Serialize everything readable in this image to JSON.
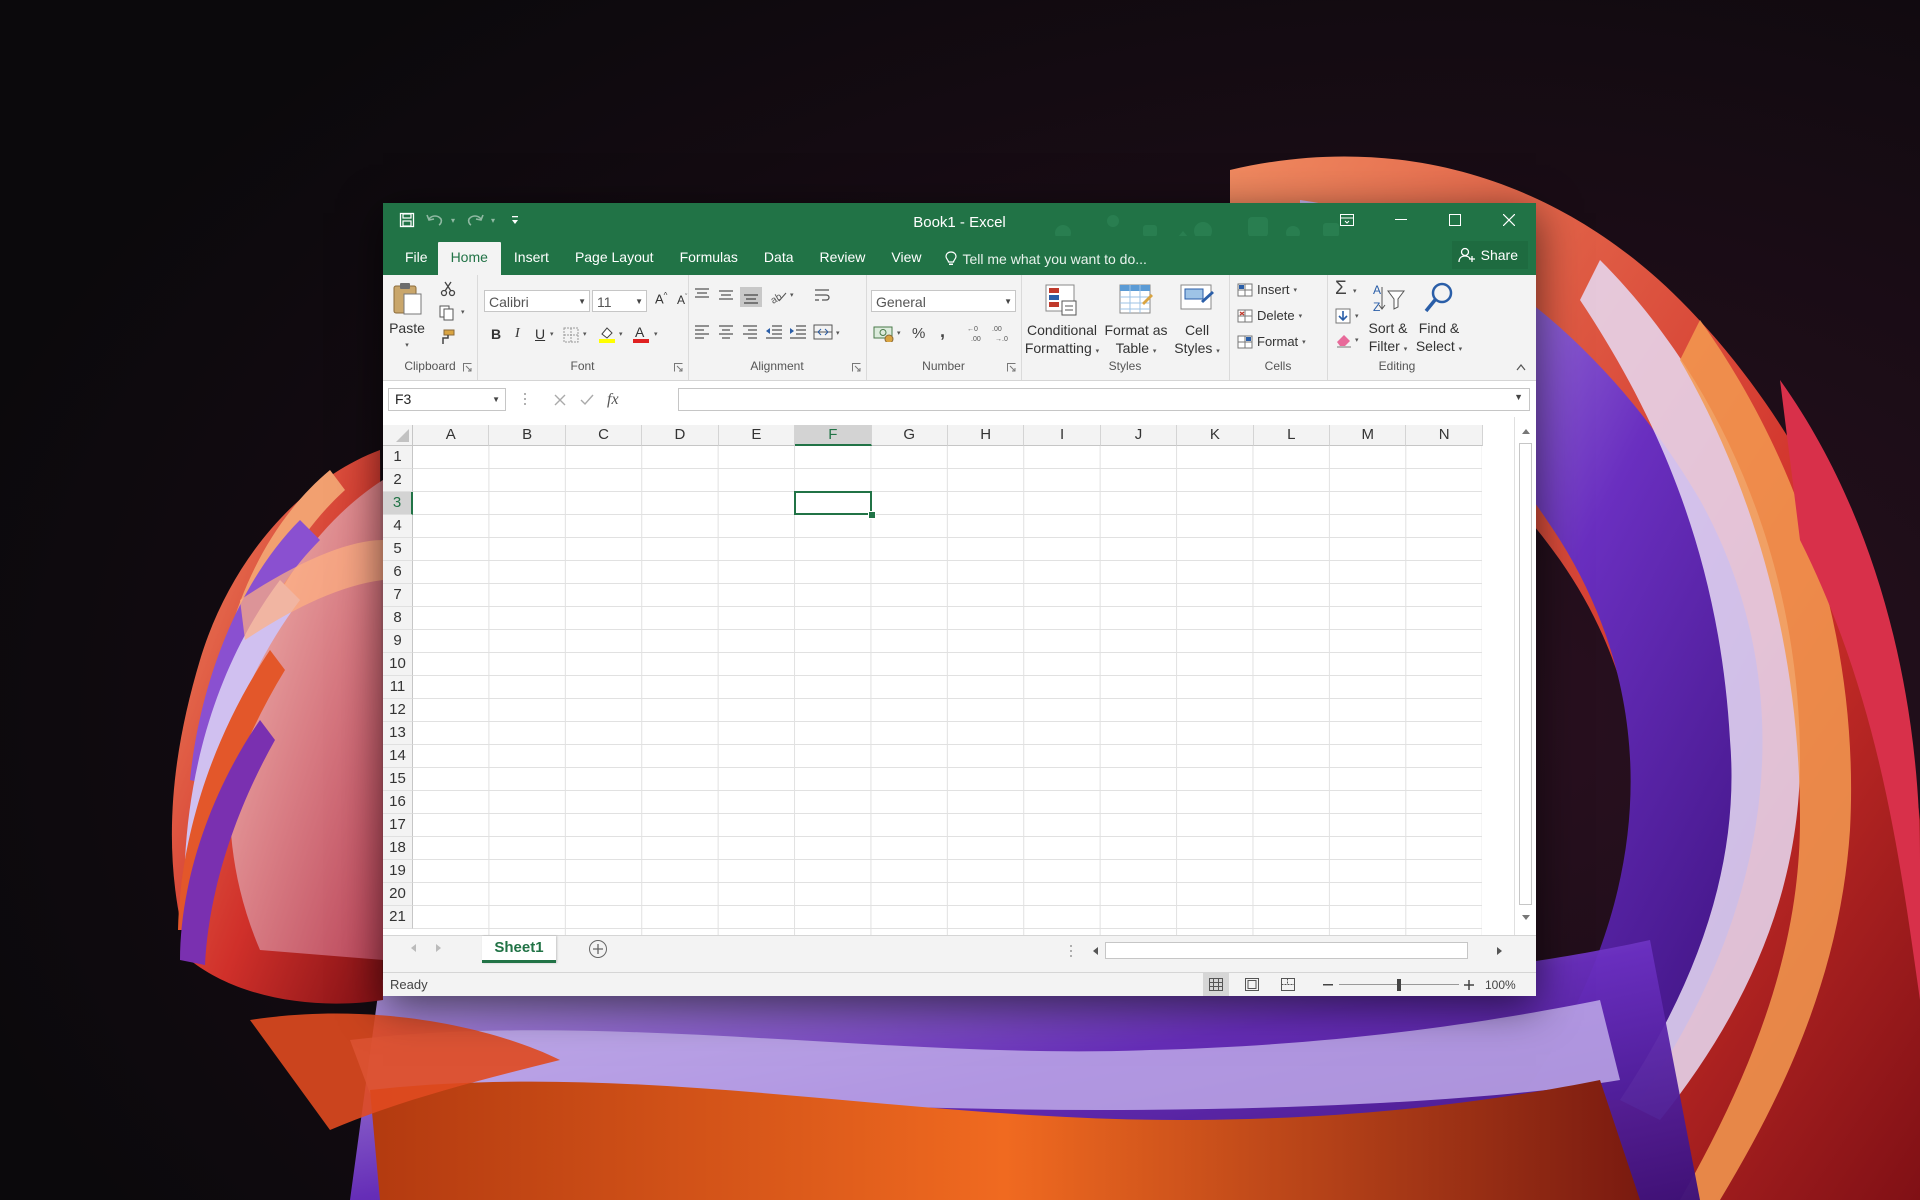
{
  "window": {
    "title": "Book1 - Excel",
    "accent_color": "#217346"
  },
  "quick_access": {
    "icons": [
      "save-icon",
      "undo-icon",
      "redo-icon",
      "customize-qat-icon"
    ]
  },
  "ribbon_tabs": {
    "file": "File",
    "home": "Home",
    "insert": "Insert",
    "page_layout": "Page Layout",
    "formulas": "Formulas",
    "data": "Data",
    "review": "Review",
    "view": "View",
    "tell_me": "Tell me what you want to do...",
    "share": "Share",
    "active": "Home"
  },
  "ribbon": {
    "clipboard": {
      "paste": "Paste",
      "label": "Clipboard"
    },
    "font": {
      "name": "Calibri",
      "size": "11",
      "bold": "B",
      "italic": "I",
      "underline": "U",
      "label": "Font"
    },
    "alignment": {
      "label": "Alignment"
    },
    "number": {
      "format": "General",
      "percent": "%",
      "comma": ",",
      "label": "Number"
    },
    "styles": {
      "conditional_line1": "Conditional",
      "conditional_line2": "Formatting",
      "format_table_line1": "Format as",
      "format_table_line2": "Table",
      "cell_styles_line1": "Cell",
      "cell_styles_line2": "Styles",
      "label": "Styles"
    },
    "cells": {
      "insert": "Insert",
      "delete": "Delete",
      "format": "Format",
      "label": "Cells"
    },
    "editing": {
      "sort_line1": "Sort &",
      "sort_line2": "Filter",
      "find_line1": "Find &",
      "find_line2": "Select",
      "label": "Editing"
    }
  },
  "formula_bar": {
    "name_box": "F3",
    "fx": "fx",
    "value": ""
  },
  "grid": {
    "columns": [
      "A",
      "B",
      "C",
      "D",
      "E",
      "F",
      "G",
      "H",
      "I",
      "J",
      "K",
      "L",
      "M",
      "N"
    ],
    "rows": [
      "1",
      "2",
      "3",
      "4",
      "5",
      "6",
      "7",
      "8",
      "9",
      "10",
      "11",
      "12",
      "13",
      "14",
      "15",
      "16",
      "17",
      "18",
      "19",
      "20",
      "21"
    ],
    "selected_cell": "F3",
    "selected_column": "F",
    "selected_row": "3"
  },
  "sheets": {
    "tabs": [
      "Sheet1"
    ],
    "active": "Sheet1"
  },
  "status": {
    "text": "Ready",
    "zoom": "100%",
    "zoom_level": 100
  }
}
